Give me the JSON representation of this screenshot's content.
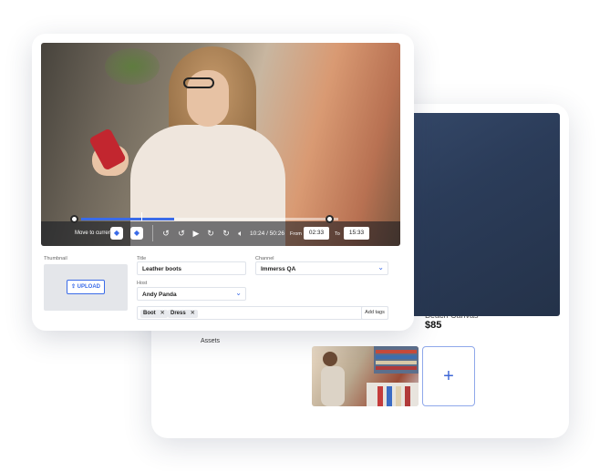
{
  "editor": {
    "player": {
      "move_to_current_label": "Move to current",
      "time_display": "10:24 / 50:26",
      "from_label": "From",
      "from_value": "02:33",
      "to_label": "To",
      "to_value": "15:33",
      "progress_fraction": 0.36,
      "trim_start_fraction": 0.0,
      "trim_end_fraction": 1.0,
      "icons": [
        "align-start-icon",
        "align-end-icon",
        "rewind-10-icon",
        "rewind-icon",
        "play-icon",
        "forward-icon",
        "forward-10-icon",
        "volume-icon"
      ]
    },
    "thumbnail_label": "Thumbnail",
    "upload_label": "UPLOAD",
    "title_label": "Title",
    "title_value": "Leather boots",
    "channel_label": "Channel",
    "channel_value": "Immerss QA",
    "host_label": "Host",
    "host_value": "Andy Panda",
    "tags": [
      "Boot",
      "Dress"
    ],
    "add_tags_label": "Add tags"
  },
  "details": {
    "selects": [
      "",
      "QA",
      "QA"
    ],
    "product": {
      "name": "Beach Canvas",
      "price": "$85"
    },
    "assets_label": "Assets",
    "accent_color": "#3d66d6"
  }
}
